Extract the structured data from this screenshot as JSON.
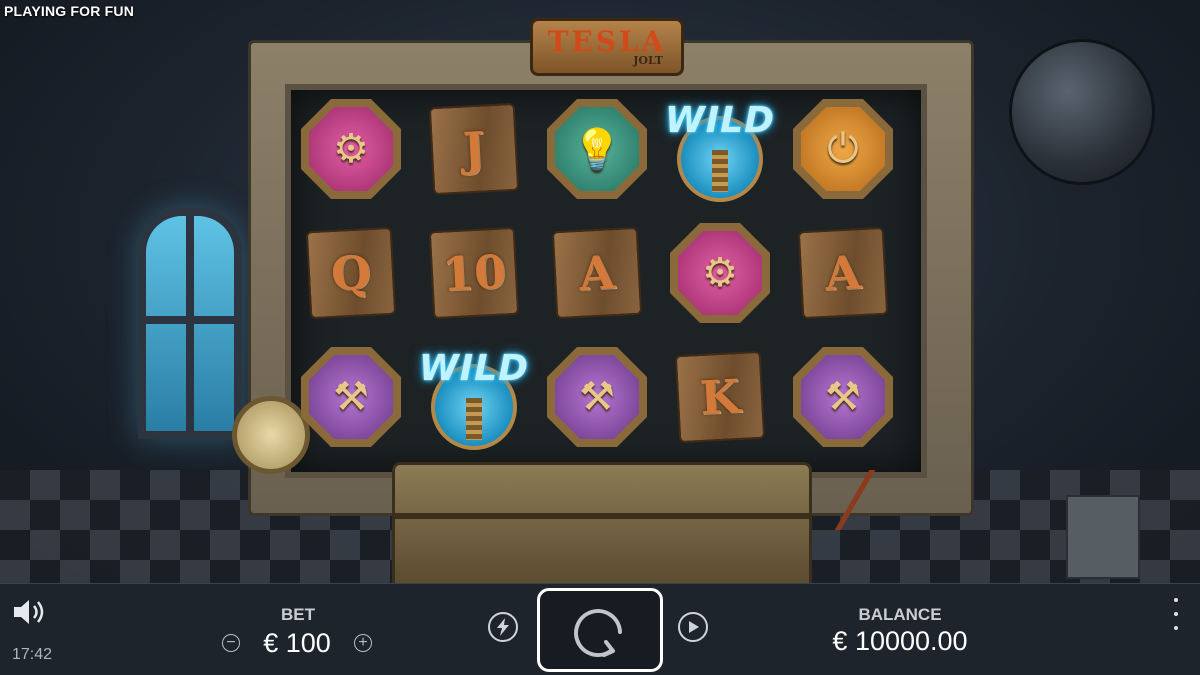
{
  "header": {
    "mode_label": "PLAYING FOR FUN"
  },
  "game": {
    "logo_main": "TESLA",
    "logo_sub": "JOLT",
    "reels": [
      [
        {
          "symbol": "generator",
          "icon": "generator-icon",
          "frame": "pink"
        },
        {
          "symbol": "letter",
          "text": "Q"
        },
        {
          "symbol": "telegraph-key",
          "icon": "telegraph-key-icon",
          "frame": "purple"
        }
      ],
      [
        {
          "symbol": "letter",
          "text": "J"
        },
        {
          "symbol": "letter",
          "text": "10"
        },
        {
          "symbol": "wild",
          "text": "WILD"
        }
      ],
      [
        {
          "symbol": "lightbulb",
          "icon": "lightbulb-icon",
          "frame": "green"
        },
        {
          "symbol": "letter",
          "text": "A"
        },
        {
          "symbol": "telegraph-key",
          "icon": "telegraph-key-icon",
          "frame": "purple"
        }
      ],
      [
        {
          "symbol": "wild",
          "text": "WILD"
        },
        {
          "symbol": "generator",
          "icon": "generator-icon",
          "frame": "pink"
        },
        {
          "symbol": "letter",
          "text": "K"
        }
      ],
      [
        {
          "symbol": "plug",
          "icon": "plug-icon",
          "frame": "orange"
        },
        {
          "symbol": "letter",
          "text": "A"
        },
        {
          "symbol": "telegraph-key",
          "icon": "telegraph-key-icon",
          "frame": "purple"
        }
      ]
    ]
  },
  "controls": {
    "bet_label": "BET",
    "bet_value": "€ 100",
    "balance_label": "BALANCE",
    "balance_value": "€ 10000.00",
    "clock": "17:42",
    "decrease_glyph": "−",
    "increase_glyph": "+"
  },
  "colors": {
    "bar_background": "#1e242c",
    "accent_white": "#ffffff",
    "wild_glow": "#2fc4ff"
  }
}
